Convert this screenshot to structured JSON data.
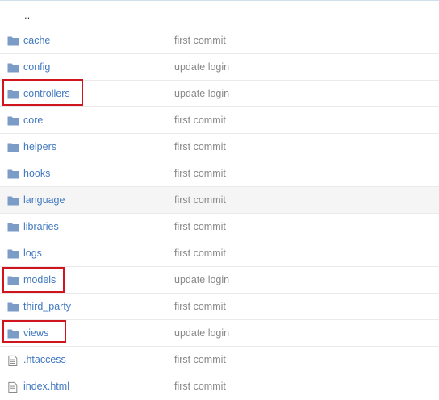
{
  "parent_dir": {
    "label": ".."
  },
  "entries": [
    {
      "type": "folder",
      "name": "cache",
      "message": "first commit"
    },
    {
      "type": "folder",
      "name": "config",
      "message": "update login"
    },
    {
      "type": "folder",
      "name": "controllers",
      "message": "update login",
      "highlighted": true
    },
    {
      "type": "folder",
      "name": "core",
      "message": "first commit"
    },
    {
      "type": "folder",
      "name": "helpers",
      "message": "first commit"
    },
    {
      "type": "folder",
      "name": "hooks",
      "message": "first commit"
    },
    {
      "type": "folder",
      "name": "language",
      "message": "first commit",
      "hovered": true
    },
    {
      "type": "folder",
      "name": "libraries",
      "message": "first commit"
    },
    {
      "type": "folder",
      "name": "logs",
      "message": "first commit"
    },
    {
      "type": "folder",
      "name": "models",
      "message": "update login",
      "highlighted": true
    },
    {
      "type": "folder",
      "name": "third_party",
      "message": "first commit"
    },
    {
      "type": "folder",
      "name": "views",
      "message": "update login",
      "highlighted": true
    },
    {
      "type": "file",
      "name": ".htaccess",
      "message": "first commit"
    },
    {
      "type": "file",
      "name": "index.html",
      "message": "first commit"
    }
  ],
  "icons": {
    "folder": "folder-icon",
    "file": "file-icon"
  },
  "colors": {
    "link": "#4078c0",
    "message": "#888888",
    "folder_icon": "#7a9cc6",
    "highlight_border": "#d0151c",
    "hover_row": "#f5f5f5"
  }
}
